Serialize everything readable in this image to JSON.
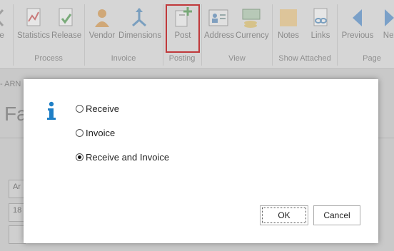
{
  "ribbon": {
    "buttons": {
      "cut_label": "te",
      "statistics": "Statistics",
      "release": "Release",
      "vendor": "Vendor",
      "dimensions": "Dimensions",
      "post": "Post",
      "address": "Address",
      "currency": "Currency",
      "notes": "Notes",
      "links": "Links",
      "previous": "Previous",
      "next": "Nex"
    },
    "groups": {
      "process": "Process",
      "invoice": "Invoice",
      "posting": "Posting",
      "view": "View",
      "show_attached": "Show Attached",
      "page": "Page"
    }
  },
  "background": {
    "breadcrumb": "- ARN",
    "title": "Fa",
    "field1": "Ar",
    "field2": "18"
  },
  "dialog": {
    "options": [
      {
        "label": "Receive",
        "checked": false
      },
      {
        "label": "Invoice",
        "checked": false
      },
      {
        "label": "Receive and Invoice",
        "checked": true
      }
    ],
    "ok_label": "OK",
    "cancel_label": "Cancel"
  },
  "colors": {
    "ribbon_bg": "#d6d6d6",
    "highlight": "#c0393b",
    "info_icon": "#1e7fc6"
  }
}
